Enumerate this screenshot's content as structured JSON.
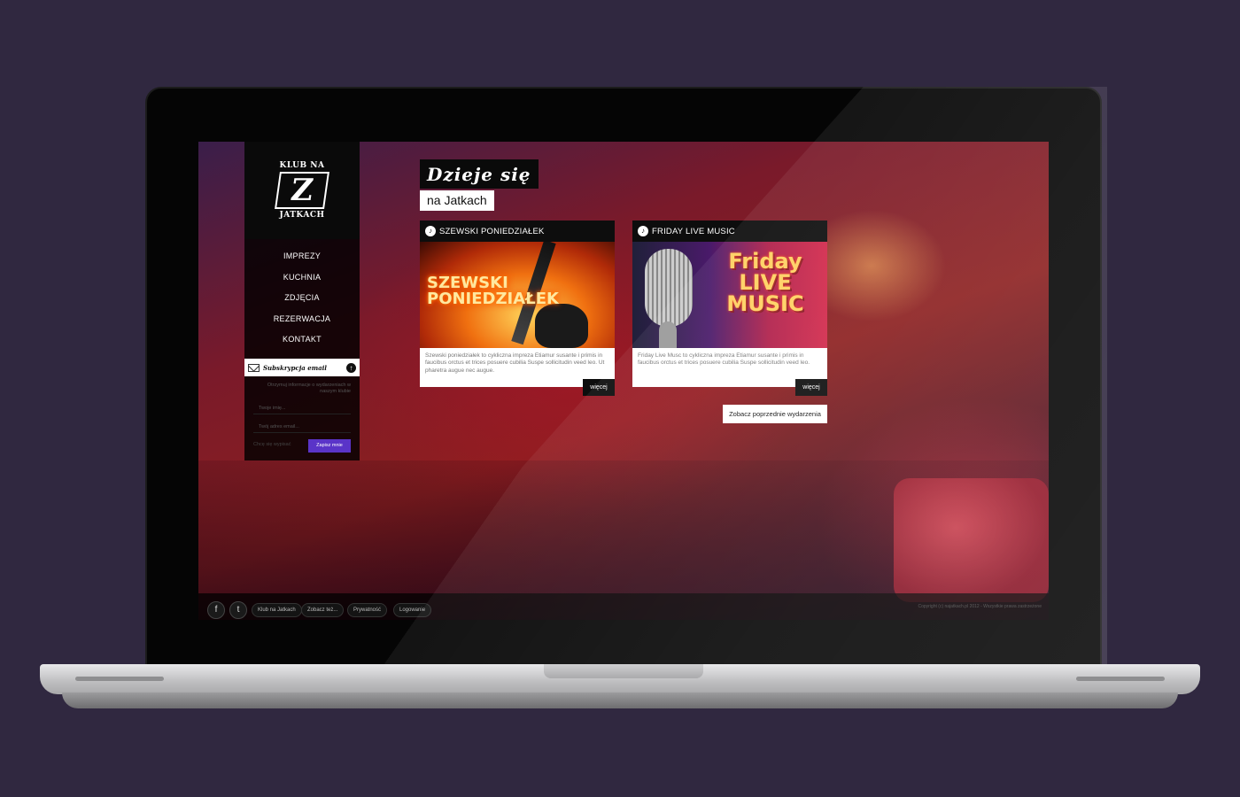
{
  "logo": {
    "line_top": "KLUB NA",
    "mark": "Z",
    "line_bottom": "JATKACH"
  },
  "nav": [
    {
      "label": "IMPREZY"
    },
    {
      "label": "KUCHNIA"
    },
    {
      "label": "ZDJĘCIA"
    },
    {
      "label": "REZERWACJA"
    },
    {
      "label": "KONTAKT"
    }
  ],
  "subscribe": {
    "title": "Subskrypcja email",
    "toggle": "↑",
    "info": "Otrzymuj informacje o wydarzeniach w naszym klubie",
    "name_placeholder": "Twoje imię...",
    "email_placeholder": "Twój adres email...",
    "unsubscribe": "Chcę się wypisać",
    "button": "Zapisz mnie"
  },
  "heading": {
    "title": "Dzieje się",
    "subtitle": "na Jatkach"
  },
  "events": [
    {
      "title": "SZEWSKI PONIEDZIAŁEK",
      "image_text_1": "SZEWSKI",
      "image_text_2": "PONIEDZIAŁEK",
      "description": "Szewski poniedziałek to cykliczna impreza Etiamur susante i primis in faucibus orctus et trices posuere cubilia Suspe sollicitudin veed leo. Ut pharetra augue nec augue.",
      "more": "więcej"
    },
    {
      "title": "FRIDAY LIVE MUSIC",
      "image_text_1": "Friday",
      "image_text_2": "LIVE",
      "image_text_3": "MUSIC",
      "description": "Friday Live Musc to cykliczna impreza Etiamur susante i primis in faucibus orctus et trices posuere cubilia Suspe sollicitudin veed leo.",
      "more": "więcej"
    }
  ],
  "prev_events": "Zobacz poprzednie wydarzenia",
  "footer": {
    "social": [
      {
        "icon": "facebook-icon",
        "glyph": "f"
      },
      {
        "icon": "twitter-icon",
        "glyph": "t"
      }
    ],
    "links": [
      "Klub na Jatkach",
      "Zobacz też...",
      "Prywatność",
      "Logowanie"
    ],
    "copyright": "Copyright (c) najatkach.pl 2012 - Wszystkie prawa zastrzeżone"
  },
  "colors": {
    "page_bg": "#302840",
    "accent": "#5a34c8",
    "card_bg": "#ffffff",
    "dark": "#0d0d0d"
  }
}
